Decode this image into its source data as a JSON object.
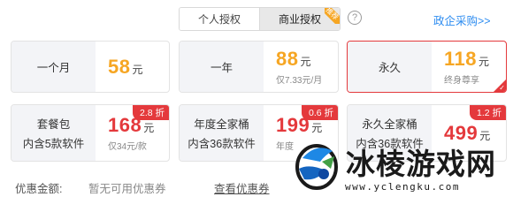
{
  "tabs": [
    {
      "label": "个人授权",
      "active": false
    },
    {
      "label": "商业授权",
      "active": true,
      "badge": "推荐"
    }
  ],
  "help_icon": "question-circle-icon",
  "enterprise_link": "政企采购>>",
  "plans": [
    {
      "name": "一个月",
      "sub": "",
      "price": "58",
      "unit": "元",
      "note": "",
      "price_color": "#f6a623",
      "discount": "",
      "selected": false
    },
    {
      "name": "一年",
      "sub": "",
      "price": "88",
      "unit": "元",
      "note": "仅7.33元/月",
      "price_color": "#f6a623",
      "discount": "",
      "selected": false
    },
    {
      "name": "永久",
      "sub": "",
      "price": "118",
      "unit": "元",
      "note": "终身尊享",
      "price_color": "#f6a623",
      "discount": "",
      "selected": true
    },
    {
      "name": "套餐包",
      "sub": "内含5款软件",
      "price": "168",
      "unit": "元",
      "note": "仅34元/款",
      "price_color": "#e4393c",
      "discount": "2.8 折",
      "selected": false
    },
    {
      "name": "年度全家桶",
      "sub": "内含36款软件",
      "price": "199",
      "unit": "元",
      "note": "年度",
      "price_color": "#e4393c",
      "discount": "0.6 折",
      "selected": false
    },
    {
      "name": "永久全家桶",
      "sub": "内含36款软件",
      "price": "499",
      "unit": "元",
      "note": "",
      "price_color": "#e4393c",
      "discount": "1.2 折",
      "selected": false
    }
  ],
  "coupon": {
    "label": "优惠金额:",
    "value": "暂无可用优惠券",
    "link": "查看优惠券"
  },
  "watermark": {
    "title": "冰棱游戏网",
    "url": "www.yclengku.com",
    "logo": "game-logo-icon"
  }
}
